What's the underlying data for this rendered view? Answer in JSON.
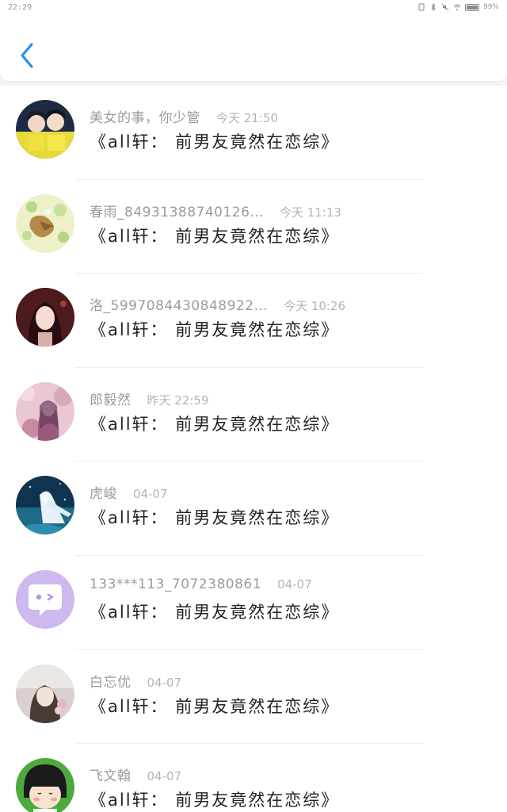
{
  "status_bar": {
    "time": "22:29",
    "battery": "99%"
  },
  "header": {
    "back_icon": "chevron-left-icon",
    "accent_color": "#2a8ef0"
  },
  "items": [
    {
      "username": "美女的事，你少管",
      "time": "今天 21:50",
      "message": "《all轩：  前男友竟然在恋综》"
    },
    {
      "username": "春雨_84931388740126…",
      "time": "今天 11:13",
      "message": "《all轩：  前男友竟然在恋综》"
    },
    {
      "username": "洛_5997084430848922…",
      "time": "今天 10:26",
      "message": "《all轩：  前男友竟然在恋综》"
    },
    {
      "username": "郎毅然",
      "time": "昨天 22:59",
      "message": "《all轩：  前男友竟然在恋综》"
    },
    {
      "username": "虎峻",
      "time": "04-07",
      "message": "《all轩：  前男友竟然在恋综》"
    },
    {
      "username": "133***113_7072380861",
      "time": "04-07",
      "message": "《all轩：  前男友竟然在恋综》"
    },
    {
      "username": "白忘优",
      "time": "04-07",
      "message": "《all轩：  前男友竟然在恋综》"
    },
    {
      "username": "飞文翰",
      "time": "04-07",
      "message": "《all轩：  前男友竟然在恋综》"
    }
  ]
}
